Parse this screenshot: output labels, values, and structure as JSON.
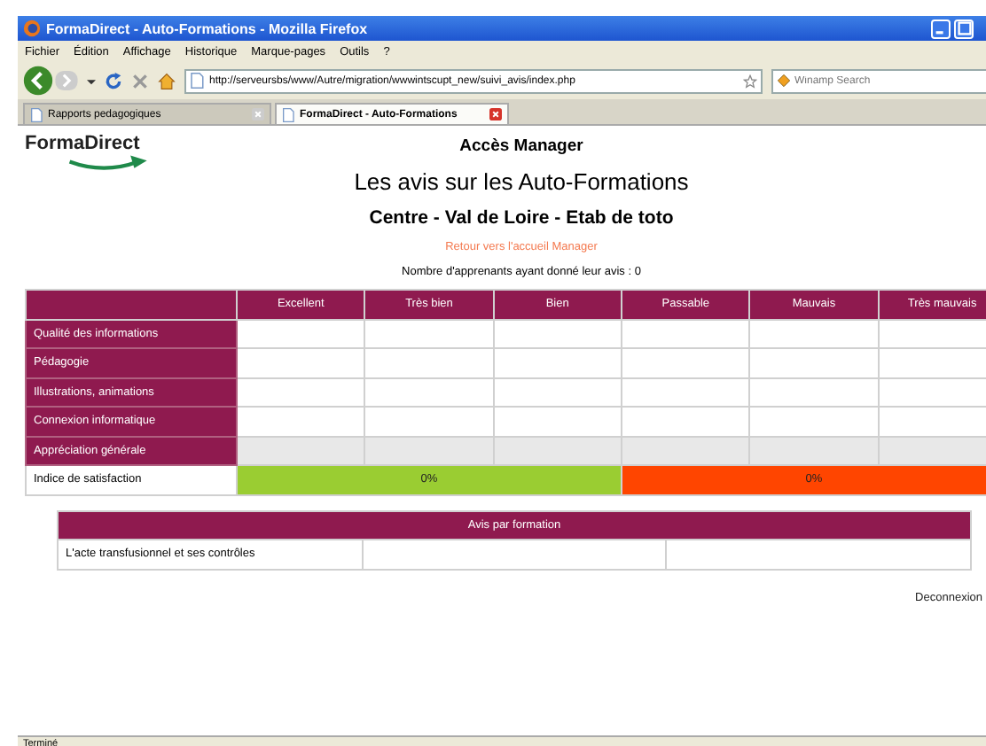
{
  "window": {
    "title": "FormaDirect - Auto-Formations - Mozilla Firefox"
  },
  "menu": [
    "Fichier",
    "Édition",
    "Affichage",
    "Historique",
    "Marque-pages",
    "Outils",
    "?"
  ],
  "nav": {
    "url": "http://serveursbs/www/Autre/migration/wwwintscupt_new/suivi_avis/index.php",
    "search_placeholder": "Winamp Search"
  },
  "tabs": [
    {
      "label": "Rapports pedagogiques",
      "selected": false
    },
    {
      "label": "FormaDirect - Auto-Formations",
      "selected": true
    }
  ],
  "page": {
    "logo": "FormaDirect",
    "heading": "Accès Manager",
    "title": "Les avis sur les Auto-Formations",
    "subtitle": "Centre - Val de Loire - Etab de toto",
    "back_link": "Retour vers l'accueil Manager",
    "count": "Nombre d'apprenants ayant donné leur avis : 0",
    "ratings": {
      "columns": [
        "Excellent",
        "Très bien",
        "Bien",
        "Passable",
        "Mauvais",
        "Très mauvais"
      ],
      "rows": [
        {
          "label": "Qualité des informations",
          "kind": "criterion"
        },
        {
          "label": "Pédagogie",
          "kind": "criterion"
        },
        {
          "label": "Illustrations, animations",
          "kind": "criterion"
        },
        {
          "label": "Connexion informatique",
          "kind": "criterion"
        },
        {
          "label": "Appréciation générale",
          "kind": "summary"
        }
      ],
      "satisfaction": {
        "label": "Indice de satisfaction",
        "segments": [
          {
            "value": "0%",
            "color": "#9acd32"
          },
          {
            "value": "0%",
            "color": "#ff4500"
          }
        ]
      }
    },
    "by_training": {
      "header": "Avis par formation",
      "rows": [
        {
          "name": "L'acte transfusionnel et ses contrôles"
        }
      ]
    },
    "logout": "Deconnexion"
  },
  "status_bar": "Terminé"
}
